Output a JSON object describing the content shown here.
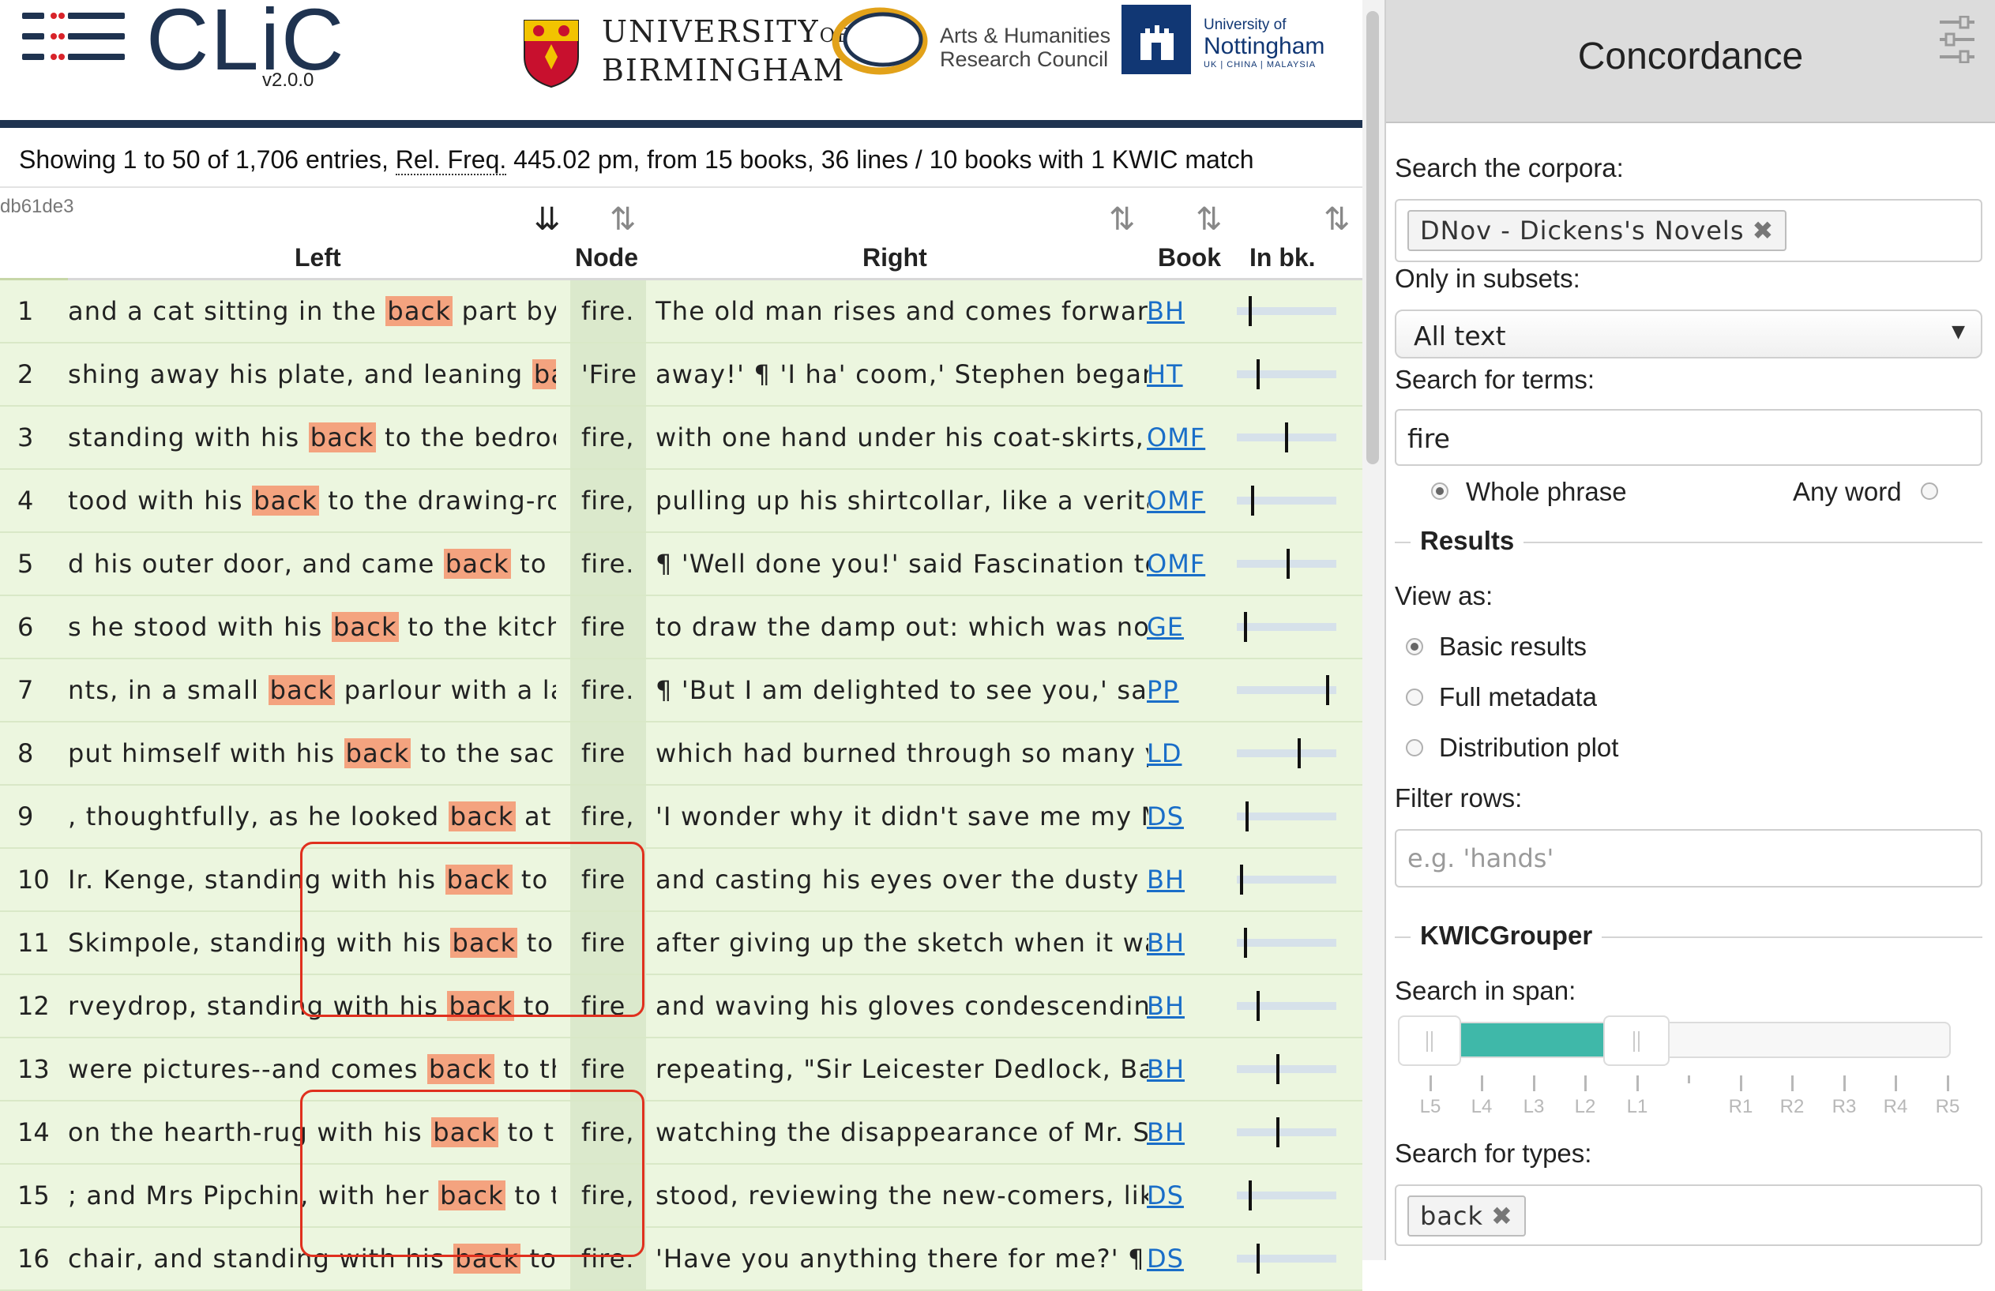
{
  "app": {
    "logo": "CLiC",
    "version": "v2.0.0",
    "partners": {
      "uob_line1": "UNIVERSITY",
      "uob_of": "OF",
      "uob_line2": "BIRMINGHAM",
      "ahrc_line1": "Arts & Humanities",
      "ahrc_line2": "Research Council",
      "nott_line1": "University of",
      "nott_line2": "Nottingham",
      "nott_line3": "UK | CHINA | MALAYSIA"
    }
  },
  "summary": {
    "prefix": "Showing 1 to 50 of 1,706 entries,",
    "relfreq_label": "Rel. Freq.",
    "suffix": "445.02 pm, from 15 books, 36 lines / 10 books with 1 KWIC match"
  },
  "hash": "db61de3",
  "table": {
    "headers": {
      "left": "Left",
      "node": "Node",
      "right": "Right",
      "book": "Book",
      "inbk": "In bk."
    },
    "rows": [
      {
        "num": "1",
        "left_pre": "and a cat sitting in the ",
        "kw": "back",
        "left_post": " part by a",
        "node": "fire.",
        "right": "The old man rises and comes forward, w",
        "book": "BH",
        "pos": 0.1
      },
      {
        "num": "2",
        "left_pre": "shing away his plate, and leaning ",
        "kw": "back",
        "left_post": ".",
        "node": "'Fire",
        "right": "away!' ¶ 'I ha' coom,' Stephen began, ra",
        "book": "HT",
        "pos": 0.18
      },
      {
        "num": "3",
        "left_pre": "standing with his ",
        "kw": "back",
        "left_post": " to the bedroom",
        "node": "fire,",
        "right": "with one hand under his coat-skirts, and",
        "book": "OMF",
        "pos": 0.5
      },
      {
        "num": "4",
        "left_pre": "tood with his ",
        "kw": "back",
        "left_post": " to the drawing-room",
        "node": "fire,",
        "right": "pulling up his shirtcollar, like a veritable",
        "book": "OMF",
        "pos": 0.12
      },
      {
        "num": "5",
        "left_pre": "d his outer door, and came ",
        "kw": "back",
        "left_post": " to his",
        "node": "fire.",
        "right": "¶ 'Well done you!' said Fascination to hi",
        "book": "OMF",
        "pos": 0.52
      },
      {
        "num": "6",
        "left_pre": "s he stood with his ",
        "kw": "back",
        "left_post": " to the kitchen",
        "node": "fire",
        "right": "to draw the damp out: which was not ca",
        "book": "GE",
        "pos": 0.04
      },
      {
        "num": "7",
        "left_pre": "nts, in a small ",
        "kw": "back",
        "left_post": " parlour with a large",
        "node": "fire.",
        "right": "¶ 'But I am delighted to see you,' said M",
        "book": "PP",
        "pos": 0.96
      },
      {
        "num": "8",
        "left_pre": "put himself with his ",
        "kw": "back",
        "left_post": " to the sacred",
        "node": "fire",
        "right": "which had burned through so many yea",
        "book": "LD",
        "pos": 0.64
      },
      {
        "num": "9",
        "left_pre": ", thoughtfully, as he looked ",
        "kw": "back",
        "left_post": " at the",
        "node": "fire,",
        "right": "'I wonder why it didn't save me my Man",
        "book": "DS",
        "pos": 0.06
      },
      {
        "num": "10",
        "left_pre": "Ir. Kenge, standing with his ",
        "kw": "back",
        "left_post": " to the",
        "node": "fire",
        "right": "and casting his eyes over the dusty hea",
        "book": "BH",
        "pos": 0.0
      },
      {
        "num": "11",
        "left_pre": "Skimpole, standing with his ",
        "kw": "back",
        "left_post": " to the",
        "node": "fire",
        "right": "after giving up the sketch when it was l",
        "book": "BH",
        "pos": 0.04
      },
      {
        "num": "12",
        "left_pre": "rveydrop, standing with his ",
        "kw": "back",
        "left_post": " to the",
        "node": "fire",
        "right": "and waving his gloves condescendingly.",
        "book": "BH",
        "pos": 0.18
      },
      {
        "num": "13",
        "left_pre": "were pictures--and comes ",
        "kw": "back",
        "left_post": " to the",
        "node": "fire",
        "right": "repeating, \"Sir Leicester Dedlock, Baron",
        "book": "BH",
        "pos": 0.4
      },
      {
        "num": "14",
        "left_pre": "on the hearth-rug with his ",
        "kw": "back",
        "left_post": " to the",
        "node": "fire,",
        "right": "watching the disappearance of Mr. Smal",
        "book": "BH",
        "pos": 0.4
      },
      {
        "num": "15",
        "left_pre": "; and Mrs Pipchin, with her ",
        "kw": "back",
        "left_post": " to the",
        "node": "fire,",
        "right": "stood, reviewing the new-comers, like a",
        "book": "DS",
        "pos": 0.1
      },
      {
        "num": "16",
        "left_pre": "chair, and standing with his ",
        "kw": "back",
        "left_post": " to the",
        "node": "fire.",
        "right": "'Have you anything there for me?' ¶ 'I di",
        "book": "DS",
        "pos": 0.18
      }
    ]
  },
  "panel": {
    "title": "Concordance",
    "search_corpora_label": "Search the corpora:",
    "corpus_tag": "DNov - Dickens's Novels",
    "subsets_label": "Only in subsets:",
    "subset_value": "All text",
    "terms_label": "Search for terms:",
    "terms_value": "fire",
    "whole_phrase": "Whole phrase",
    "any_word": "Any word",
    "results_title": "Results",
    "view_as_label": "View as:",
    "view_options": [
      "Basic results",
      "Full metadata",
      "Distribution plot"
    ],
    "filter_label": "Filter rows:",
    "filter_placeholder": "e.g. 'hands'",
    "kwic_title": "KWICGrouper",
    "span_label": "Search in span:",
    "span_ticks": [
      "L5",
      "L4",
      "L3",
      "L2",
      "L1",
      "R1",
      "R2",
      "R3",
      "R4",
      "R5"
    ],
    "span_range": [
      "L4",
      "L1"
    ],
    "types_label": "Search for types:",
    "type_tag": "back"
  },
  "colors": {
    "navy": "#1f3350",
    "row_bg": "#ecf6df",
    "node_bg": "#dbe9cc",
    "highlight": "#f4a37f",
    "link": "#1a6ec8",
    "slider_fill": "#3fb8a9",
    "annotation_box": "#e0301e"
  }
}
